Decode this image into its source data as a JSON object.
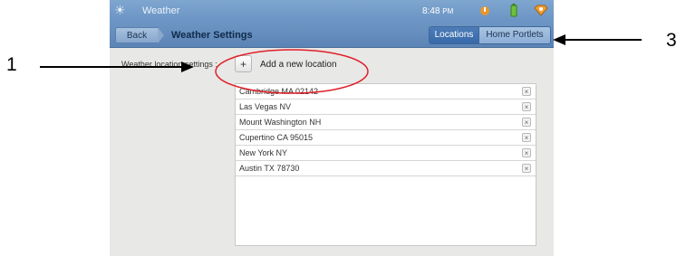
{
  "callouts": {
    "one": "1",
    "three": "3"
  },
  "statusbar": {
    "app_title": "Weather",
    "time": "8:48",
    "ampm": "PM",
    "icons": [
      "weather-app-icon",
      "alert-icon",
      "battery-icon",
      "notification-icon"
    ]
  },
  "titlebar": {
    "back_label": "Back",
    "title": "Weather Settings",
    "tabs": [
      {
        "label": "Locations",
        "selected": true
      },
      {
        "label": "Home Portlets",
        "selected": false
      }
    ]
  },
  "settings": {
    "label": "Weather location settings :",
    "add_button": "+",
    "add_label": "Add a new location"
  },
  "locations": [
    "Cambridge MA 02142",
    "Las Vegas NV",
    "Mount Washington NH",
    "Cupertino CA 95015",
    "New York NY",
    "Austin TX 78730"
  ],
  "delete_glyph": "×",
  "colors": {
    "header": "#6a94c4",
    "selected_tab": "#376aa9",
    "annotation_circle": "#e0202a"
  }
}
